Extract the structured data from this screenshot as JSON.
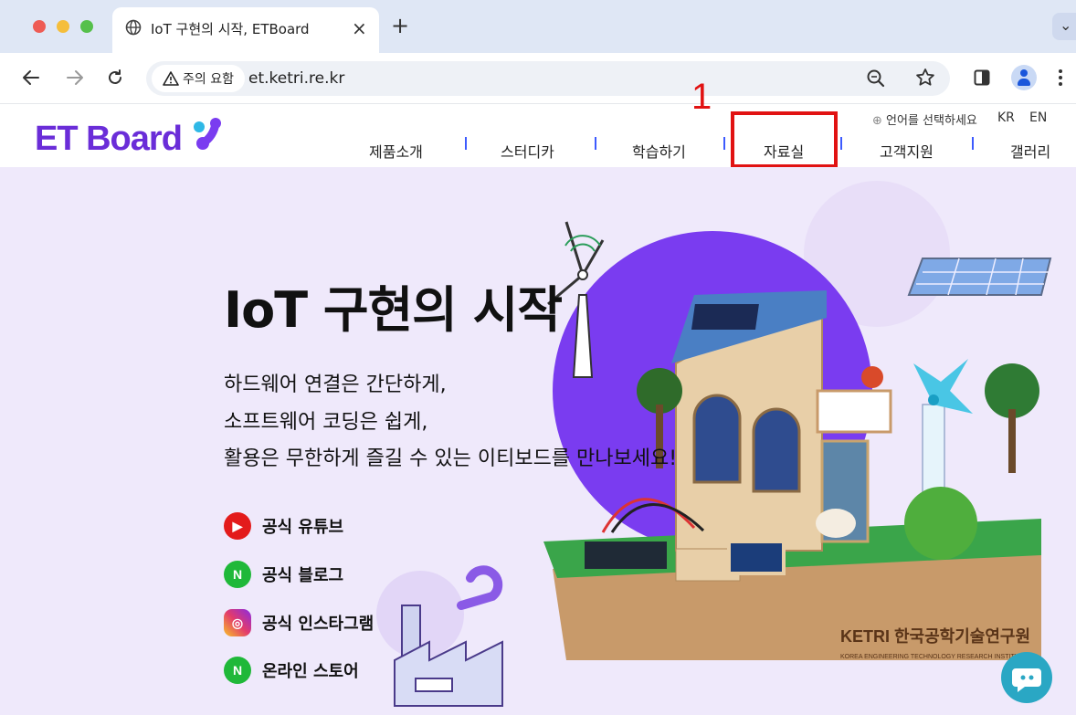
{
  "browser": {
    "tab_title": "IoT 구현의 시작, ETBoard",
    "tab_close": "×",
    "new_tab": "+",
    "tab_menu": "⌄",
    "security_label": "주의 요함",
    "url": "et.ketri.re.kr",
    "icons": [
      "globe-icon",
      "back-icon",
      "forward-icon",
      "reload-icon",
      "warning-icon",
      "zoom-icon",
      "star-icon",
      "sidepanel-icon",
      "profile-icon",
      "menu-icon"
    ]
  },
  "site": {
    "logo_text": "ET Board",
    "language_select": "언어를 선택하세요",
    "lang_kr": "KR",
    "lang_en": "EN",
    "nav": [
      "제품소개",
      "스터디카",
      "학습하기",
      "자료실",
      "고객지원",
      "갤러리"
    ],
    "accent": "#6a2dd8"
  },
  "annotation": {
    "marker": "1",
    "highlight_color": "#e11212"
  },
  "hero": {
    "title": "IoT 구현의 시작",
    "lines": [
      "하드웨어 연결은 간단하게,",
      "소프트웨어 코딩은 쉽게,",
      "활용은 무한하게 즐길 수 있는 이티보드를 만나보세요!"
    ],
    "social": [
      {
        "label": "공식 유튜브",
        "icon": "youtube-icon"
      },
      {
        "label": "공식 블로그",
        "icon": "naver-icon",
        "glyph": "N"
      },
      {
        "label": "공식 인스타그램",
        "icon": "instagram-icon"
      },
      {
        "label": "온라인 스토어",
        "icon": "naver-icon",
        "glyph": "N"
      }
    ],
    "ketri_text": "KETRI 한국공학기술연구원",
    "ketri_sub": "KOREA ENGINEERING TECHNOLOGY RESEARCH INSTITUTE",
    "bg_color": "#efe9fb",
    "circle_color": "#7a3cf0"
  }
}
